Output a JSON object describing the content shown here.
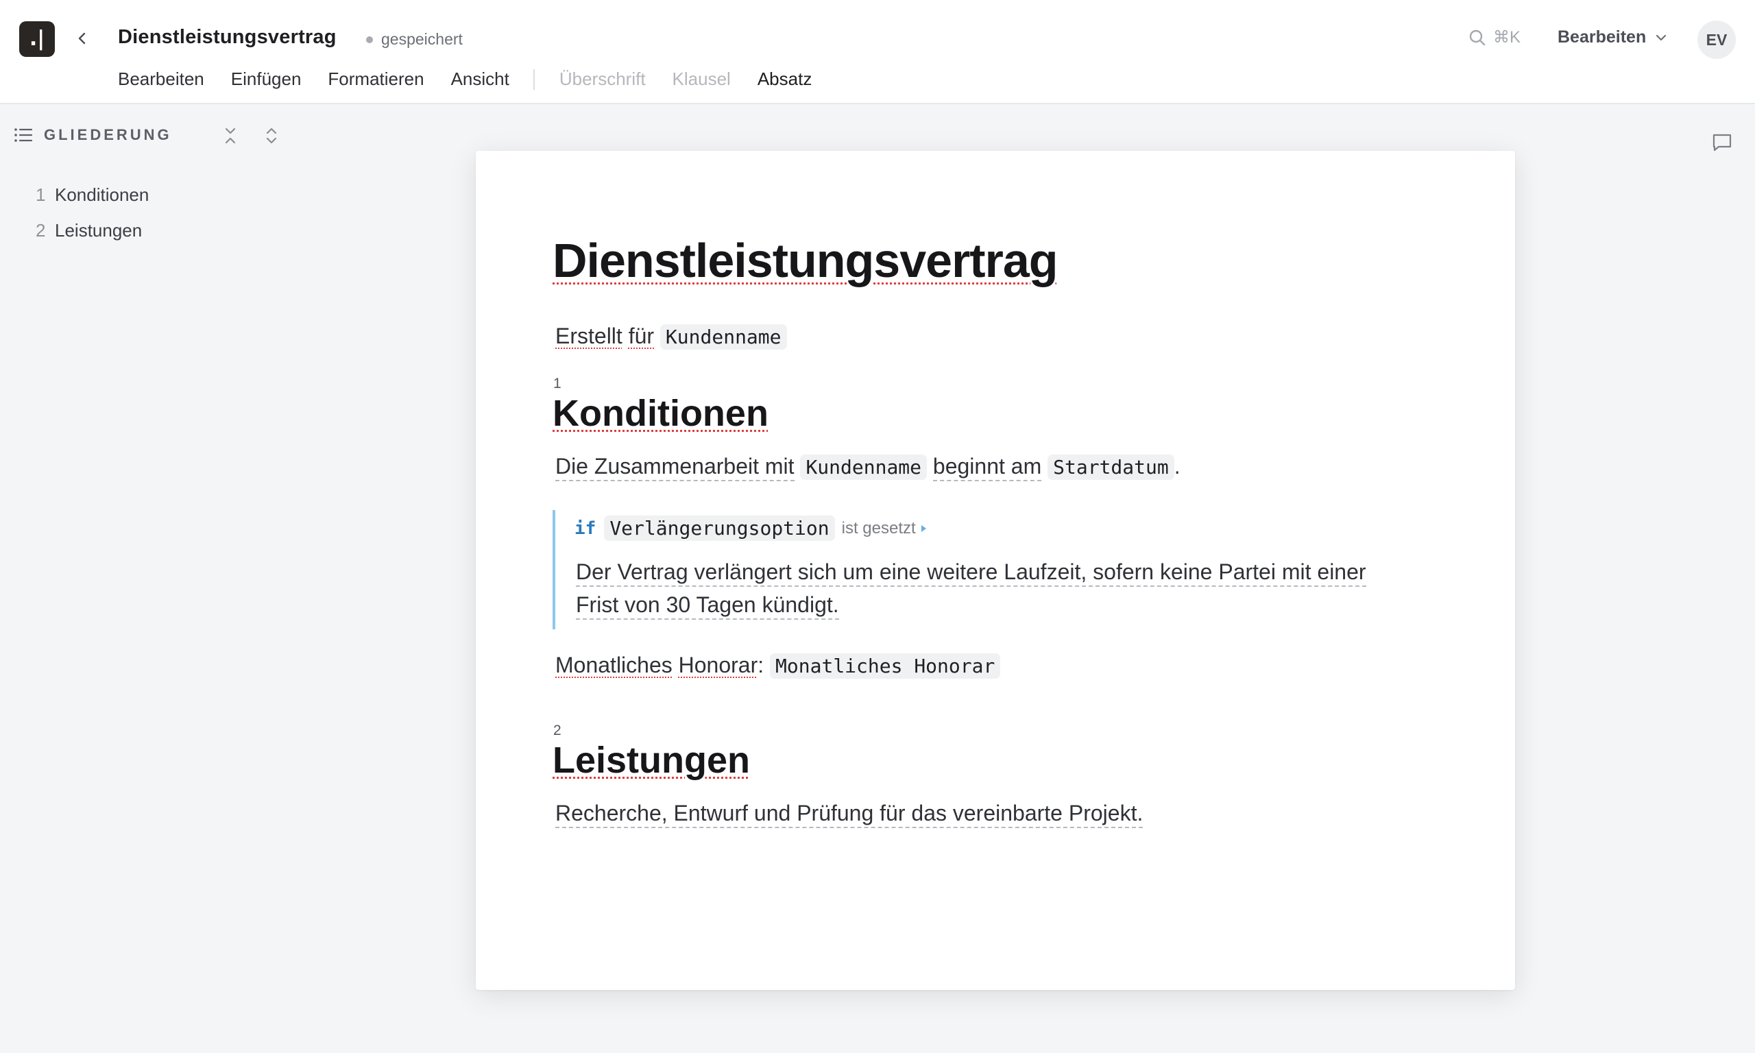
{
  "header": {
    "logo_text": ".|",
    "doc_title": "Dienstleistungsvertrag",
    "save_status": "gespeichert",
    "search_shortcut": "⌘K",
    "mode_label": "Bearbeiten",
    "avatar_initials": "EV",
    "menu": [
      "Bearbeiten",
      "Einfügen",
      "Formatieren",
      "Ansicht"
    ],
    "styles": [
      "Überschrift",
      "Klausel",
      "Absatz"
    ],
    "active_style": "Absatz"
  },
  "outline": {
    "title": "GLIEDERUNG",
    "items": [
      {
        "num": "1",
        "label": "Konditionen"
      },
      {
        "num": "2",
        "label": "Leistungen"
      }
    ]
  },
  "document": {
    "title": "Dienstleistungsvertrag",
    "created_for_w1": "Erstellt",
    "created_for_w2": "für",
    "created_for_var": "Kundenname",
    "sections": [
      {
        "num": "1",
        "title": "Konditionen",
        "p1_pre": "Die Zusammenarbeit mit",
        "p1_var1": "Kundenname",
        "p1_mid": "beginnt am",
        "p1_var2": "Startdatum",
        "p1_post": ".",
        "condition": {
          "keyword": "if",
          "variable": "Verlängerungsoption",
          "operator": "ist gesetzt",
          "text": "Der Vertrag verlängert sich um eine weitere Laufzeit, sofern keine Partei mit einer Frist von 30 Tagen kündigt."
        },
        "fee_w1": "Monatliches",
        "fee_w2": "Honorar",
        "fee_colon": ":",
        "fee_var": "Monatliches Honorar"
      },
      {
        "num": "2",
        "title": "Leistungen",
        "p1": "Recherche, Entwurf und Prüfung für das vereinbarte Projekt."
      }
    ]
  },
  "colors": {
    "accent_if": "#2a7bbd",
    "condition_bar": "#8cc8ee",
    "spellcheck": "#e03c3c"
  }
}
